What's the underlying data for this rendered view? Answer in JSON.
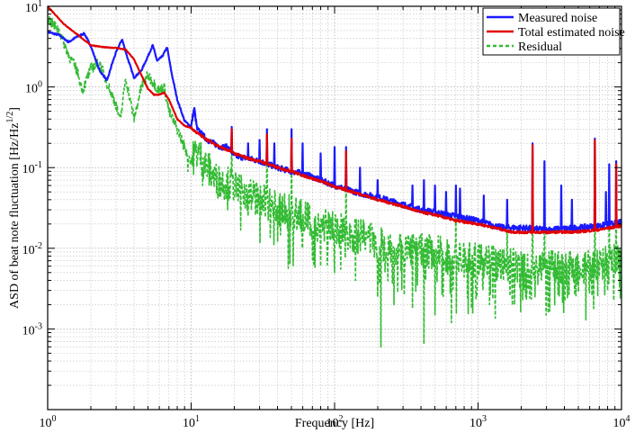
{
  "chart_data": {
    "type": "line",
    "title": "",
    "xlabel": "Frequency [Hz]",
    "ylabel_prefix": "ASD of beat note fluctuation [Hz/Hz",
    "ylabel_exponent": "1/2",
    "ylabel_suffix": "]",
    "x_scale": "log",
    "y_scale": "log",
    "xlim": [
      1,
      10000
    ],
    "ylim": [
      0.0001,
      10
    ],
    "grid": true,
    "legend_position": "top-right",
    "x_ticks": [
      {
        "value": 1,
        "base": "10",
        "exp": "0"
      },
      {
        "value": 10,
        "base": "10",
        "exp": "1"
      },
      {
        "value": 100,
        "base": "10",
        "exp": "2"
      },
      {
        "value": 1000,
        "base": "10",
        "exp": "3"
      },
      {
        "value": 10000,
        "base": "10",
        "exp": "4"
      }
    ],
    "y_ticks": [
      {
        "value": 0.001,
        "base": "10",
        "exp": "-3"
      },
      {
        "value": 0.01,
        "base": "10",
        "exp": "-2"
      },
      {
        "value": 0.1,
        "base": "10",
        "exp": "-1"
      },
      {
        "value": 1,
        "base": "10",
        "exp": "0"
      },
      {
        "value": 10,
        "base": "10",
        "exp": "1"
      }
    ],
    "series": [
      {
        "name": "Measured noise",
        "color": "#1a1aff",
        "style": "solid",
        "points": [
          [
            1,
            4.8
          ],
          [
            1.2,
            4.4
          ],
          [
            1.4,
            3.6
          ],
          [
            1.6,
            4.2
          ],
          [
            1.8,
            4.6
          ],
          [
            2,
            3.2
          ],
          [
            2.3,
            1.6
          ],
          [
            2.6,
            1.2
          ],
          [
            2.8,
            1.9
          ],
          [
            3,
            2.7
          ],
          [
            3.3,
            3.9
          ],
          [
            3.6,
            2.3
          ],
          [
            4,
            1.3
          ],
          [
            4.5,
            1.6
          ],
          [
            5,
            2.4
          ],
          [
            5.4,
            3.3
          ],
          [
            5.8,
            2.1
          ],
          [
            6.3,
            2.4
          ],
          [
            6.8,
            3.1
          ],
          [
            7.3,
            1.5
          ],
          [
            8,
            0.7
          ],
          [
            9,
            0.38
          ],
          [
            10,
            0.32
          ],
          [
            10.5,
            0.55
          ],
          [
            11,
            0.3
          ],
          [
            13,
            0.22
          ],
          [
            16,
            0.18
          ],
          [
            18,
            0.18
          ],
          [
            20,
            0.14
          ],
          [
            25,
            0.13
          ],
          [
            30,
            0.12
          ],
          [
            40,
            0.1
          ],
          [
            50,
            0.09
          ],
          [
            60,
            0.085
          ],
          [
            80,
            0.07
          ],
          [
            100,
            0.06
          ],
          [
            150,
            0.048
          ],
          [
            200,
            0.043
          ],
          [
            300,
            0.035
          ],
          [
            400,
            0.03
          ],
          [
            500,
            0.028
          ],
          [
            700,
            0.025
          ],
          [
            1000,
            0.022
          ],
          [
            1300,
            0.019
          ],
          [
            1500,
            0.018
          ],
          [
            2000,
            0.018
          ],
          [
            3000,
            0.017
          ],
          [
            5000,
            0.018
          ],
          [
            7000,
            0.019
          ],
          [
            10000,
            0.021
          ]
        ],
        "peaks": [
          [
            19.2,
            0.32
          ],
          [
            25,
            0.2
          ],
          [
            30,
            0.22
          ],
          [
            33.8,
            0.3
          ],
          [
            38,
            0.2
          ],
          [
            50,
            0.3
          ],
          [
            60,
            0.2
          ],
          [
            80,
            0.15
          ],
          [
            100,
            0.18
          ],
          [
            120,
            0.18
          ],
          [
            150,
            0.1
          ],
          [
            200,
            0.07
          ],
          [
            350,
            0.06
          ],
          [
            420,
            0.07
          ],
          [
            500,
            0.06
          ],
          [
            600,
            0.05
          ],
          [
            700,
            0.06
          ],
          [
            750,
            0.055
          ],
          [
            1100,
            0.045
          ],
          [
            1600,
            0.04
          ],
          [
            2400,
            0.2
          ],
          [
            2900,
            0.12
          ],
          [
            3800,
            0.06
          ],
          [
            4500,
            0.04
          ],
          [
            6500,
            0.23
          ],
          [
            7800,
            0.05
          ],
          [
            8200,
            0.11
          ],
          [
            9200,
            0.12
          ]
        ]
      },
      {
        "name": "Total estimated noise",
        "color": "#e00000",
        "style": "solid",
        "points": [
          [
            1,
            10
          ],
          [
            1.3,
            6
          ],
          [
            1.6,
            4.5
          ],
          [
            2,
            3.3
          ],
          [
            2.5,
            3.1
          ],
          [
            3,
            3.05
          ],
          [
            3.5,
            2.9
          ],
          [
            4,
            2.2
          ],
          [
            4.5,
            1.4
          ],
          [
            5,
            0.95
          ],
          [
            5.5,
            0.8
          ],
          [
            6,
            0.8
          ],
          [
            6.5,
            0.85
          ],
          [
            7,
            0.7
          ],
          [
            8,
            0.4
          ],
          [
            9,
            0.33
          ],
          [
            10,
            0.31
          ],
          [
            11,
            0.27
          ],
          [
            13,
            0.22
          ],
          [
            16,
            0.18
          ],
          [
            20,
            0.15
          ],
          [
            25,
            0.13
          ],
          [
            30,
            0.12
          ],
          [
            40,
            0.1
          ],
          [
            50,
            0.09
          ],
          [
            60,
            0.08
          ],
          [
            80,
            0.068
          ],
          [
            100,
            0.058
          ],
          [
            150,
            0.047
          ],
          [
            200,
            0.04
          ],
          [
            300,
            0.033
          ],
          [
            400,
            0.028
          ],
          [
            500,
            0.026
          ],
          [
            700,
            0.022
          ],
          [
            1000,
            0.02
          ],
          [
            1300,
            0.018
          ],
          [
            1700,
            0.016
          ],
          [
            2000,
            0.0158
          ],
          [
            3000,
            0.0158
          ],
          [
            5000,
            0.016
          ],
          [
            7000,
            0.017
          ],
          [
            10000,
            0.019
          ]
        ],
        "peaks": [
          [
            19.2,
            0.3
          ],
          [
            33.8,
            0.26
          ],
          [
            50,
            0.23
          ],
          [
            120,
            0.16
          ],
          [
            2400,
            0.19
          ],
          [
            6500,
            0.22
          ],
          [
            9200,
            0.11
          ]
        ]
      },
      {
        "name": "Residual",
        "color": "#33bb33",
        "style": "dashed",
        "points": [
          [
            1,
            7
          ],
          [
            1.2,
            5
          ],
          [
            1.4,
            2.5
          ],
          [
            1.6,
            1.6
          ],
          [
            1.75,
            0.9
          ],
          [
            2,
            1.7
          ],
          [
            2.3,
            2
          ],
          [
            2.6,
            1.1
          ],
          [
            3,
            0.6
          ],
          [
            3.2,
            0.37
          ],
          [
            3.5,
            1.3
          ],
          [
            4,
            0.4
          ],
          [
            4.5,
            1
          ],
          [
            5,
            1.4
          ],
          [
            5.5,
            1.1
          ],
          [
            6,
            0.9
          ],
          [
            6.5,
            1
          ],
          [
            7,
            0.5
          ],
          [
            8,
            0.3
          ],
          [
            9,
            0.18
          ],
          [
            10,
            0.12
          ],
          [
            11,
            0.16
          ],
          [
            13,
            0.1
          ],
          [
            15,
            0.07
          ],
          [
            20,
            0.06
          ],
          [
            30,
            0.04
          ],
          [
            40,
            0.03
          ],
          [
            50,
            0.028
          ],
          [
            70,
            0.022
          ],
          [
            100,
            0.018
          ],
          [
            150,
            0.014
          ],
          [
            200,
            0.012
          ],
          [
            300,
            0.01
          ],
          [
            500,
            0.009
          ],
          [
            700,
            0.0075
          ],
          [
            1000,
            0.007
          ],
          [
            1500,
            0.0065
          ],
          [
            2000,
            0.006
          ],
          [
            3000,
            0.0058
          ],
          [
            5000,
            0.0057
          ],
          [
            7000,
            0.006
          ],
          [
            10000,
            0.0075
          ]
        ],
        "dips": [
          [
            9.5,
            0.09
          ],
          [
            12,
            0.06
          ],
          [
            18,
            0.03
          ],
          [
            25,
            0.025
          ],
          [
            40,
            0.012
          ],
          [
            60,
            0.01
          ],
          [
            80,
            0.006
          ],
          [
            100,
            0.005
          ],
          [
            140,
            0.004
          ],
          [
            200,
            0.0025
          ],
          [
            210,
            0.0006
          ],
          [
            260,
            0.002
          ],
          [
            350,
            0.0018
          ],
          [
            420,
            0.00065
          ],
          [
            500,
            0.0015
          ],
          [
            650,
            0.0012
          ],
          [
            900,
            0.0018
          ],
          [
            1200,
            0.002
          ],
          [
            1800,
            0.002
          ],
          [
            2500,
            0.0025
          ],
          [
            4000,
            0.003
          ],
          [
            6000,
            0.0028
          ],
          [
            8000,
            0.003
          ]
        ],
        "peaks": [
          [
            19.2,
            0.3
          ],
          [
            25,
            0.15
          ],
          [
            33.8,
            0.25
          ],
          [
            50,
            0.25
          ],
          [
            100,
            0.15
          ],
          [
            120,
            0.18
          ],
          [
            200,
            0.05
          ],
          [
            420,
            0.07
          ],
          [
            700,
            0.05
          ],
          [
            1600,
            0.04
          ],
          [
            2400,
            0.2
          ],
          [
            2900,
            0.1
          ],
          [
            6500,
            0.22
          ],
          [
            8200,
            0.1
          ],
          [
            9200,
            0.12
          ]
        ]
      }
    ]
  }
}
